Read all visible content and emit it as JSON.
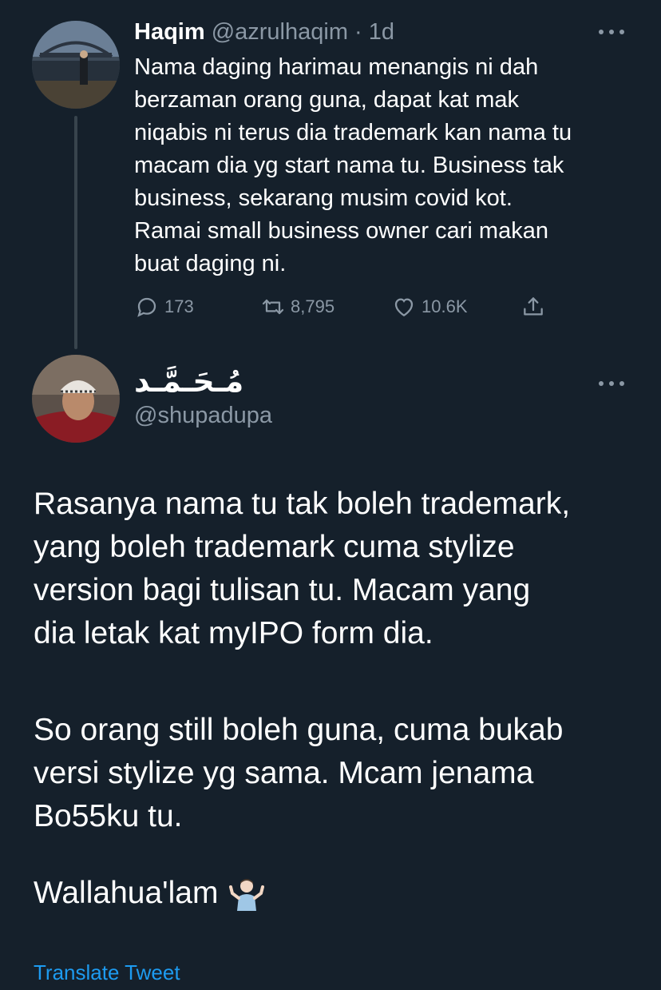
{
  "tweet1": {
    "name": "Haqim",
    "handle": "@azrulhaqim",
    "separator": "·",
    "time": "1d",
    "text": "Nama daging harimau menangis ni dah\nberzaman orang guna, dapat kat mak\nniqabis ni terus dia trademark kan nama tu\nmacam dia yg start nama tu. Business tak\nbusiness, sekarang musim covid kot.\nRamai small business owner cari makan\nbuat daging ni.",
    "replies": "173",
    "retweets": "8,795",
    "likes": "10.6K"
  },
  "tweet2": {
    "name": "مُـحَـمَّـد",
    "handle": "@shupadupa",
    "paragraphs": [
      "Rasanya nama tu tak boleh trademark,\nyang boleh trademark cuma stylize\nversion bagi tulisan tu. Macam yang\ndia letak kat myIPO form dia.",
      "So orang still boleh guna, cuma bukab\nversi stylize yg sama. Mcam jenama\nBo55ku tu.",
      "Wallahua'lam"
    ],
    "emoji_icon": "person-shrugging-icon",
    "translate_label": "Translate Tweet"
  },
  "colors": {
    "background": "#15202b",
    "muted": "#8b98a5",
    "link": "#1d9bf0"
  }
}
